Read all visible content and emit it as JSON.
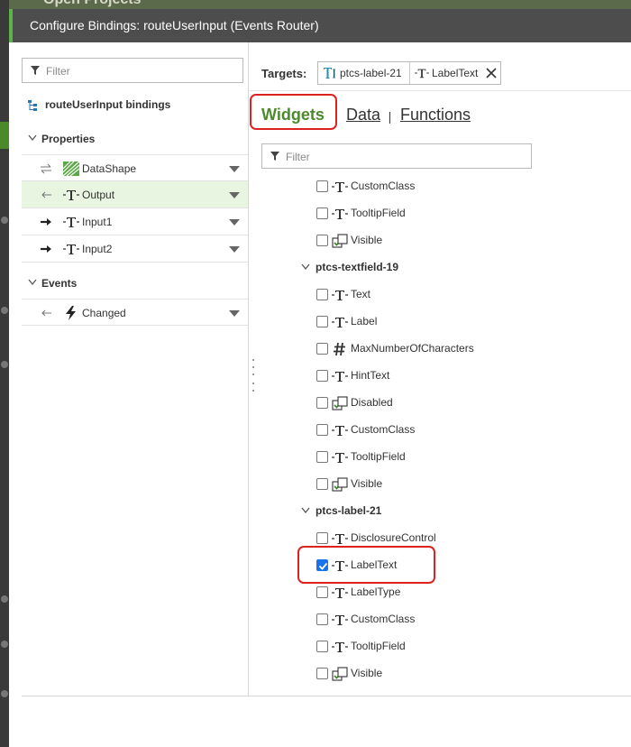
{
  "background": {
    "app_title": "Open Projects"
  },
  "dialog": {
    "title": "Configure Bindings: routeUserInput (Events Router)"
  },
  "left_panel": {
    "filter_placeholder": "Filter",
    "root_label": "routeUserInput bindings",
    "properties_label": "Properties",
    "properties": [
      {
        "label": "DataShape",
        "icon": "infotable-icon",
        "direction": "bidirectional",
        "selected": false
      },
      {
        "label": "Output",
        "icon": "string-type-icon",
        "direction": "inbound",
        "selected": true
      },
      {
        "label": "Input1",
        "icon": "string-type-icon",
        "direction": "outbound",
        "selected": false
      },
      {
        "label": "Input2",
        "icon": "string-type-icon",
        "direction": "outbound",
        "selected": false
      }
    ],
    "events_label": "Events",
    "events": [
      {
        "label": "Changed",
        "icon": "lightning-icon",
        "direction": "inbound"
      }
    ]
  },
  "right_panel": {
    "targets_label": "Targets:",
    "target_chips": [
      {
        "label": "ptcs-label-21",
        "icon": "label-widget-icon"
      },
      {
        "label": "LabelText",
        "icon": "string-type-icon"
      }
    ],
    "tabs": [
      {
        "label": "Widgets",
        "active": true
      },
      {
        "label": "Data",
        "active": false
      },
      {
        "label": "Functions",
        "active": false
      }
    ],
    "filter_placeholder": "Filter",
    "items": [
      {
        "kind": "prop",
        "label": "CustomClass",
        "icon": "string-type-icon",
        "checked": false
      },
      {
        "kind": "prop",
        "label": "TooltipField",
        "icon": "string-type-icon",
        "checked": false
      },
      {
        "kind": "prop",
        "label": "Visible",
        "icon": "boolean-type-icon",
        "checked": false
      },
      {
        "kind": "group",
        "label": "ptcs-textfield-19"
      },
      {
        "kind": "prop",
        "label": "Text",
        "icon": "string-type-icon",
        "checked": false
      },
      {
        "kind": "prop",
        "label": "Label",
        "icon": "string-type-icon",
        "checked": false
      },
      {
        "kind": "prop",
        "label": "MaxNumberOfCharacters",
        "icon": "number-type-icon",
        "checked": false
      },
      {
        "kind": "prop",
        "label": "HintText",
        "icon": "string-type-icon",
        "checked": false
      },
      {
        "kind": "prop",
        "label": "Disabled",
        "icon": "boolean-type-icon",
        "checked": false
      },
      {
        "kind": "prop",
        "label": "CustomClass",
        "icon": "string-type-icon",
        "checked": false
      },
      {
        "kind": "prop",
        "label": "TooltipField",
        "icon": "string-type-icon",
        "checked": false
      },
      {
        "kind": "prop",
        "label": "Visible",
        "icon": "boolean-type-icon",
        "checked": false
      },
      {
        "kind": "group",
        "label": "ptcs-label-21"
      },
      {
        "kind": "prop",
        "label": "DisclosureControl",
        "icon": "string-type-icon",
        "checked": false
      },
      {
        "kind": "prop",
        "label": "LabelText",
        "icon": "string-type-icon",
        "checked": true,
        "highlighted": true
      },
      {
        "kind": "prop",
        "label": "LabelType",
        "icon": "string-type-icon",
        "checked": false
      },
      {
        "kind": "prop",
        "label": "CustomClass",
        "icon": "string-type-icon",
        "checked": false
      },
      {
        "kind": "prop",
        "label": "TooltipField",
        "icon": "string-type-icon",
        "checked": false
      },
      {
        "kind": "prop",
        "label": "Visible",
        "icon": "boolean-type-icon",
        "checked": false
      }
    ]
  },
  "colors": {
    "accent_green": "#4b8b2b",
    "highlight_red": "#dd2222",
    "checkbox_blue": "#1a73e8",
    "titlebar": "#4d4d4d"
  }
}
